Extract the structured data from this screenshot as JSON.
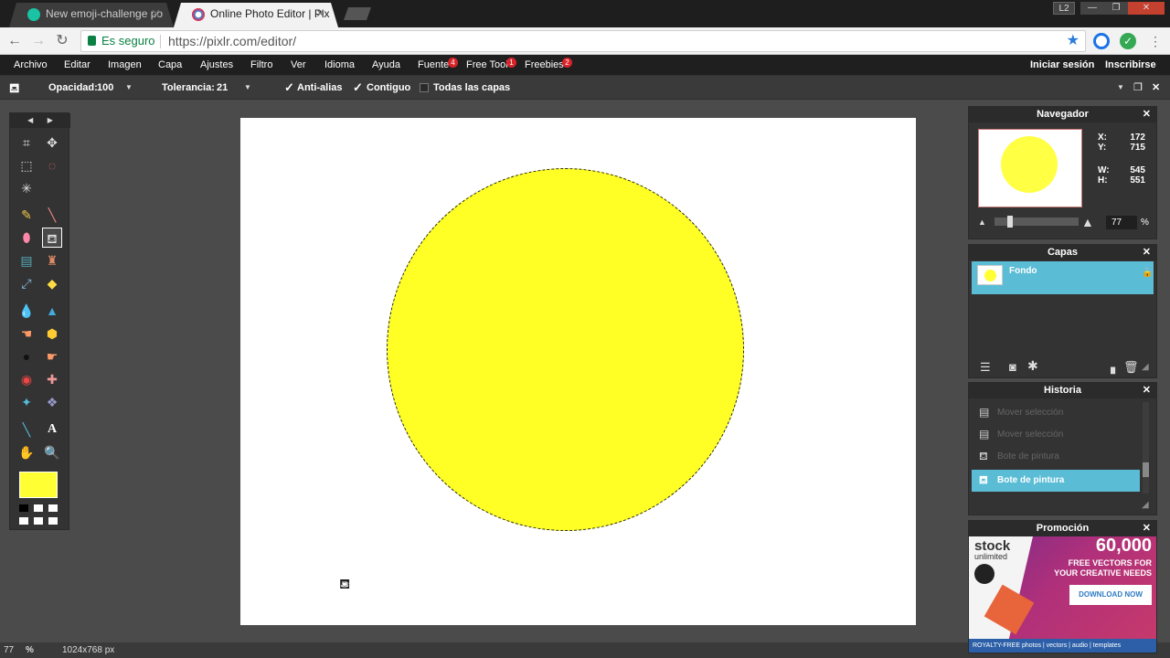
{
  "browser": {
    "tabs": [
      {
        "title": "New emoji-challenge po",
        "active": false
      },
      {
        "title": "Online Photo Editor | Pix",
        "active": true
      }
    ],
    "window_user": "L2",
    "secure_label": "Es seguro",
    "url": "https://pixlr.com/editor/"
  },
  "menubar": {
    "items": [
      "Archivo",
      "Editar",
      "Imagen",
      "Capa",
      "Ajustes",
      "Filtro",
      "Ver",
      "Idioma",
      "Ayuda",
      "Fuente",
      "Free Tool",
      "Freebies"
    ],
    "badges": {
      "Fuente": "4",
      "Free Tool": "1",
      "Freebies": "2"
    },
    "login": "Iniciar sesión",
    "signup": "Inscribirse"
  },
  "options": {
    "opacity_label": "Opacidad:",
    "opacity_value": "100",
    "tolerance_label": "Tolerancia:",
    "tolerance_value": "21",
    "antialias_label": "Anti-alias",
    "antialias_checked": true,
    "contiguous_label": "Contiguo",
    "contiguous_checked": true,
    "all_layers_label": "Todas las capas",
    "all_layers_checked": false
  },
  "toolbox": {
    "foreground_color": "#ffff33",
    "active_tool": "paint-bucket"
  },
  "canvas": {
    "fill_color": "#ffff26"
  },
  "status": {
    "zoom": "77",
    "zoom_unit": "%",
    "dimensions": "1024x768 px"
  },
  "navigator": {
    "title": "Navegador",
    "x_label": "X:",
    "x_value": "172",
    "y_label": "Y:",
    "y_value": "715",
    "w_label": "W:",
    "w_value": "545",
    "h_label": "H:",
    "h_value": "551",
    "zoom_value": "77",
    "zoom_unit": "%"
  },
  "layers": {
    "title": "Capas",
    "items": [
      {
        "name": "Fondo",
        "locked": true
      }
    ]
  },
  "history": {
    "title": "Historia",
    "items": [
      {
        "label": "Mover selección",
        "active": false
      },
      {
        "label": "Mover selección",
        "active": false
      },
      {
        "label": "Bote de pintura",
        "active": false
      },
      {
        "label": "Bote de pintura",
        "active": true
      }
    ]
  },
  "promo": {
    "title": "Promoción",
    "brand_line1": "stock",
    "brand_line2": "unlimited",
    "headline": "60,000",
    "sub1": "FREE VECTORS FOR",
    "sub2": "YOUR CREATIVE NEEDS",
    "button": "DOWNLOAD NOW",
    "footer": "ROYALTY-FREE  photos | vectors | audio | templates"
  }
}
